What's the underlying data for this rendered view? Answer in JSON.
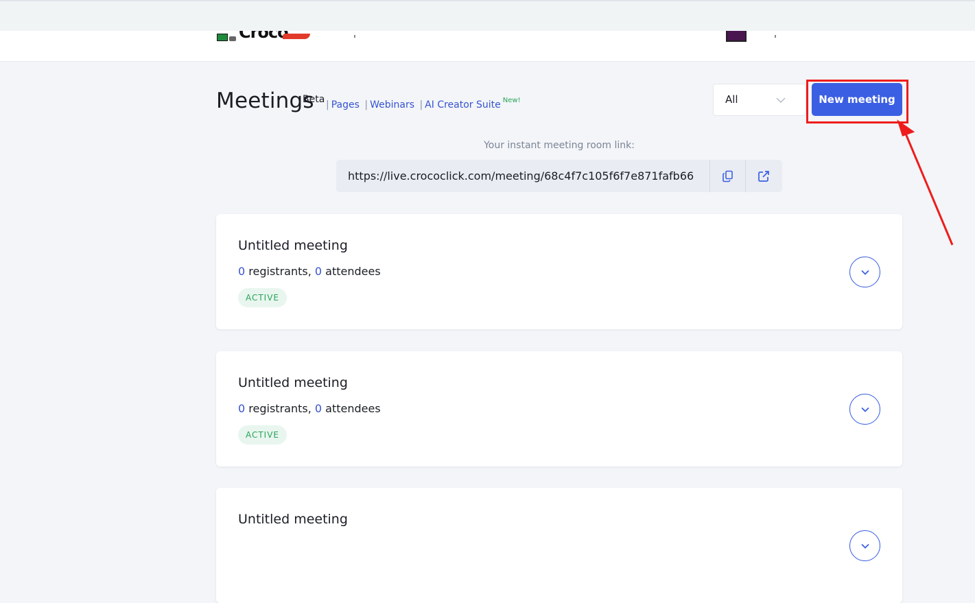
{
  "header": {
    "logo_text": "Croco",
    "title": "Meetings",
    "title_sup": "Beta",
    "links": [
      {
        "label": "Pages"
      },
      {
        "label": "Webinars"
      },
      {
        "label": "AI Creator Suite",
        "sup": "New!"
      }
    ],
    "filter": {
      "selected": "All"
    },
    "new_meeting_label": "New meeting"
  },
  "instant_link": {
    "caption": "Your instant meeting room link:",
    "url": "https://live.crococlick.com/meeting/68c4f7c105f6f7e871fafb66"
  },
  "meetings": [
    {
      "title": "Untitled meeting",
      "registrants": "0",
      "registrants_label": "registrants,",
      "attendees": "0",
      "attendees_label": "attendees",
      "status": "ACTIVE"
    },
    {
      "title": "Untitled meeting",
      "registrants": "0",
      "registrants_label": "registrants,",
      "attendees": "0",
      "attendees_label": "attendees",
      "status": "ACTIVE"
    },
    {
      "title": "Untitled meeting"
    }
  ],
  "colors": {
    "accent": "#3b5fe2",
    "highlight": "#ee1c1c",
    "status_active": "#29a35a"
  }
}
